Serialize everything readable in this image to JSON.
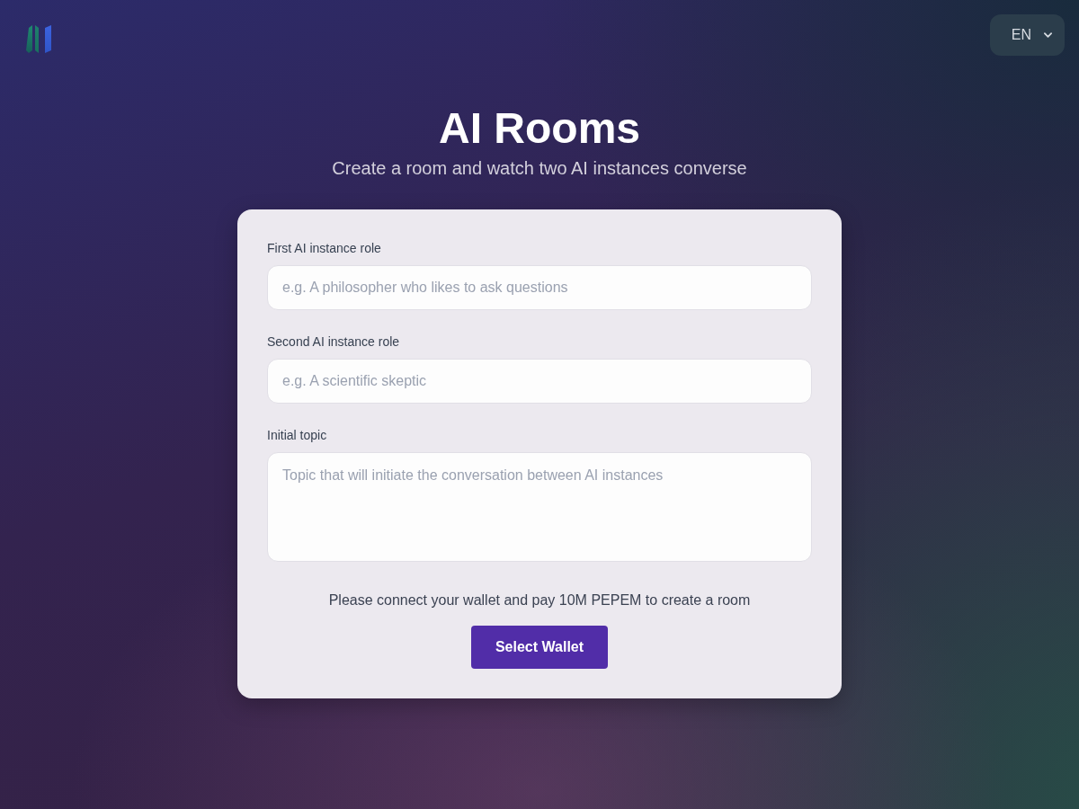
{
  "header": {
    "language": {
      "label": "EN"
    }
  },
  "hero": {
    "title": "AI Rooms",
    "subtitle": "Create a room and watch two AI instances converse"
  },
  "form": {
    "fields": [
      {
        "kind": "input",
        "label": "First AI instance role",
        "placeholder": "e.g. A philosopher who likes to ask questions"
      },
      {
        "kind": "input",
        "label": "Second AI instance role",
        "placeholder": "e.g. A scientific skeptic"
      },
      {
        "kind": "textarea",
        "label": "Initial topic",
        "placeholder": "Topic that will initiate the conversation between AI instances"
      }
    ],
    "notice": "Please connect your wallet and pay 10M PEPEM to create a room",
    "button": "Select Wallet"
  }
}
